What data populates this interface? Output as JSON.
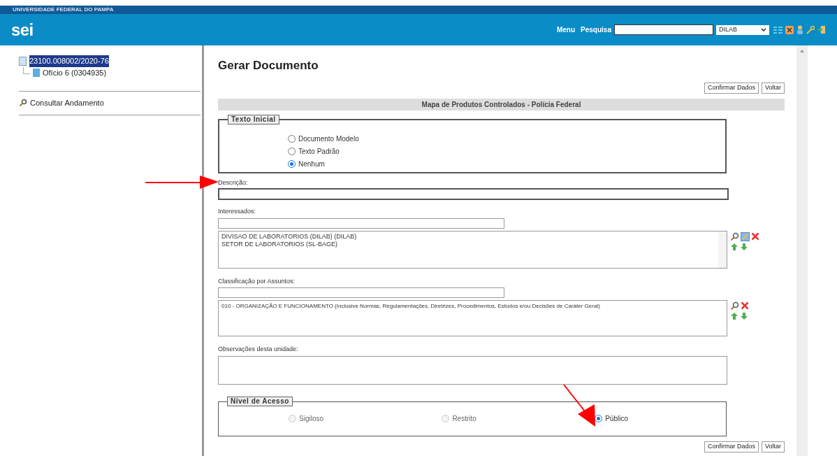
{
  "header": {
    "org": "UNIVERSIDADE FEDERAL DO PAMPA",
    "logo": "sei",
    "menu_label": "Menu",
    "search_label": "Pesquisa",
    "unit": "DILAB"
  },
  "tree": {
    "label": "23100.008002/2020-76",
    "selected": true,
    "children": [
      {
        "label": "Ofício 6 (0304935)",
        "selected": false
      }
    ]
  },
  "sidebar_action": "Consultar Andamento",
  "form": {
    "title": "Gerar Documento",
    "buttons": [
      "Confirmar Dados",
      "Voltar"
    ],
    "section_title": "Mapa de Produtos Controlados - Polícia Federal",
    "texto_inicial": {
      "legend": "Texto Inicial",
      "options": [
        {
          "label": "Documento Modelo",
          "selected": false
        },
        {
          "label": "Texto Padrão",
          "selected": false
        },
        {
          "label": "Nenhum",
          "selected": true
        }
      ]
    },
    "descricao_label": "Descrição:",
    "interessados": {
      "label": "Interessados:",
      "items": [
        "DIVISAO DE LABORATORIOS (DILAB) (DILAB)",
        "SETOR DE LABORATORIOS (SL-BAGE)"
      ]
    },
    "classificacao": {
      "label": "Classificação por Assuntos:",
      "items": [
        "010 - ORGANIZAÇÃO E FUNCIONAMENTO (Inclusive Normas, Regulamentações, Diretrizes, Procedimentos, Estudos e/ou Decisões de Caráter Geral)"
      ]
    },
    "observacoes_label": "Observações desta unidade:",
    "nivel_acesso": {
      "legend": "Nível de Acesso",
      "options": [
        {
          "label": "Sigiloso",
          "selected": false,
          "disabled": true
        },
        {
          "label": "Restrito",
          "selected": false,
          "disabled": true
        },
        {
          "label": "Público",
          "selected": true,
          "disabled": false
        }
      ]
    },
    "bottom_buttons": [
      "Confirmar Dados",
      "Voltar"
    ]
  }
}
